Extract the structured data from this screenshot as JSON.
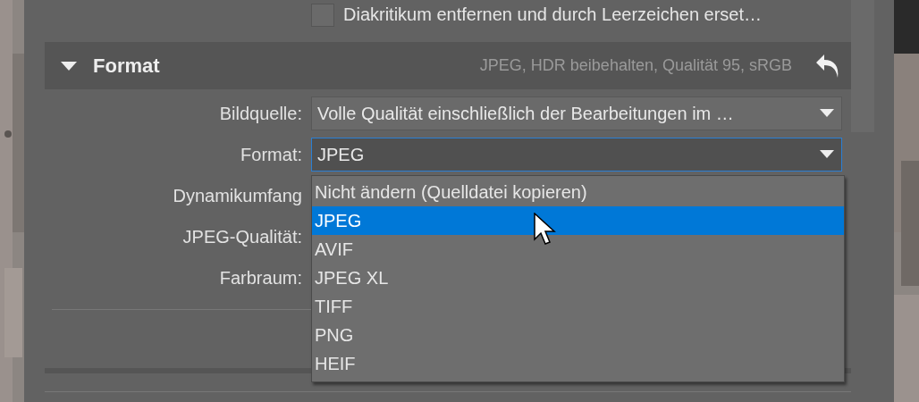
{
  "checkbox": {
    "label": "Diakritikum entfernen und durch Leerzeichen erset…",
    "checked": false
  },
  "section": {
    "title": "Format",
    "expanded": true,
    "summary": "JPEG, HDR beibehalten, Qualität 95, sRGB"
  },
  "fields": [
    {
      "label": "Bildquelle:",
      "value": "Volle Qualität einschließlich der Bearbeitungen im …",
      "focused": false
    },
    {
      "label": "Format:",
      "value": "JPEG",
      "focused": true
    },
    {
      "label": "Dynamikumfang"
    },
    {
      "label": "JPEG-Qualität:"
    },
    {
      "label": "Farbraum:"
    }
  ],
  "dropdown_options": [
    {
      "label": "Nicht ändern (Quelldatei kopieren)",
      "selected": false
    },
    {
      "label": "JPEG",
      "selected": true
    },
    {
      "label": "AVIF",
      "selected": false
    },
    {
      "label": "JPEG XL",
      "selected": false
    },
    {
      "label": "TIFF",
      "selected": false
    },
    {
      "label": "PNG",
      "selected": false
    },
    {
      "label": "HEIF",
      "selected": false
    }
  ]
}
